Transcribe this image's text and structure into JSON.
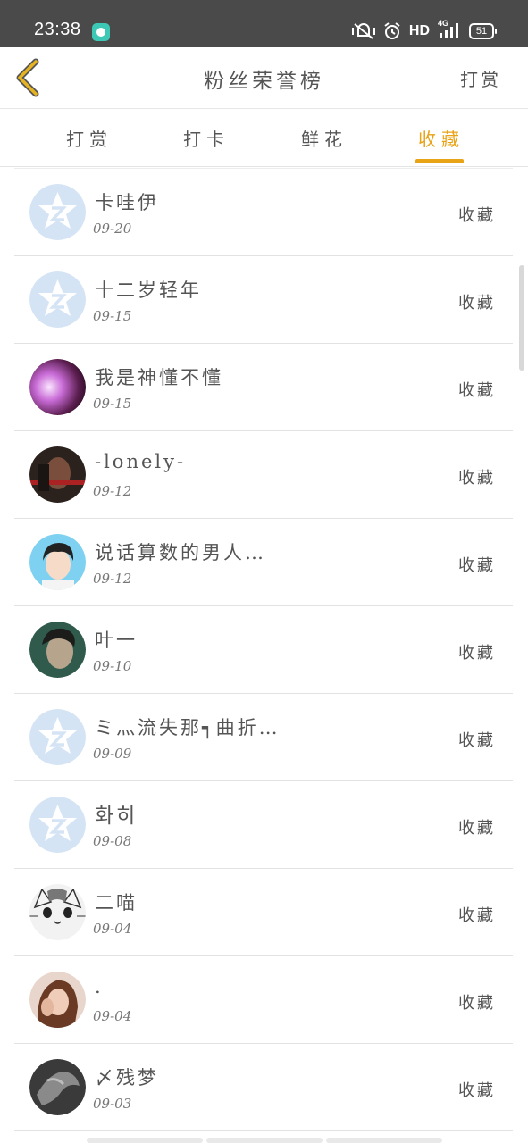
{
  "status_bar": {
    "time": "23:38",
    "network_label": "HD",
    "signal_label": "4G",
    "battery_level": "51",
    "icons": [
      "app-notification-icon",
      "mute-vibrate-icon",
      "alarm-icon",
      "signal-icon",
      "battery-icon"
    ]
  },
  "header": {
    "title": "粉丝荣誉榜",
    "action_label": "打赏",
    "back_icon": "chevron-left-icon"
  },
  "tabs": [
    {
      "label": "打赏",
      "active": false
    },
    {
      "label": "打卡",
      "active": false
    },
    {
      "label": "鲜花",
      "active": false
    },
    {
      "label": "收藏",
      "active": true
    }
  ],
  "colors": {
    "accent": "#e8a317",
    "status_bar_bg": "#4a4a4a",
    "default_avatar": "#d5e4f5",
    "text": "#555555",
    "divider": "#e2e2e2"
  },
  "list": {
    "items": [
      {
        "name": "卡哇伊",
        "date": "09-20",
        "type": "收藏",
        "avatar": "default-avatar-icon"
      },
      {
        "name": "十二岁轻年",
        "date": "09-15",
        "type": "收藏",
        "avatar": "default-avatar-icon"
      },
      {
        "name": "我是神懂不懂",
        "date": "09-15",
        "type": "收藏",
        "avatar": "user-photo"
      },
      {
        "name": "-lonely-",
        "date": "09-12",
        "type": "收藏",
        "avatar": "user-photo"
      },
      {
        "name": "说话算数的男人…",
        "date": "09-12",
        "type": "收藏",
        "avatar": "user-photo"
      },
      {
        "name": "叶一",
        "date": "09-10",
        "type": "收藏",
        "avatar": "user-photo"
      },
      {
        "name": "ミ灬流失那┑曲折…",
        "date": "09-09",
        "type": "收藏",
        "avatar": "default-avatar-icon"
      },
      {
        "name": "화히",
        "date": "09-08",
        "type": "收藏",
        "avatar": "default-avatar-icon"
      },
      {
        "name": "二喵",
        "date": "09-04",
        "type": "收藏",
        "avatar": "cat-avatar"
      },
      {
        "name": ".",
        "date": "09-04",
        "type": "收藏",
        "avatar": "user-photo"
      },
      {
        "name": "〆残梦",
        "date": "09-03",
        "type": "收藏",
        "avatar": "user-photo"
      }
    ]
  }
}
